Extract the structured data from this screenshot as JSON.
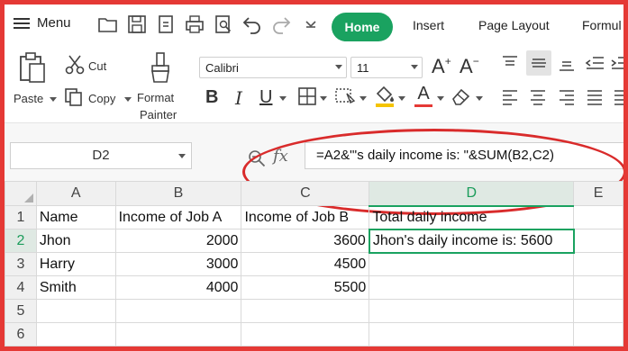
{
  "toolbar": {
    "menu_label": "Menu",
    "tabs": [
      "Home",
      "Insert",
      "Page Layout",
      "Formul"
    ],
    "accent_color": "#1aa260"
  },
  "ribbon": {
    "paste_label": "Paste",
    "cut_label": "Cut",
    "copy_label": "Copy",
    "format_painter_label_1": "Format",
    "format_painter_label_2": "Painter",
    "font_name": "Calibri",
    "font_size": "11"
  },
  "formula_bar": {
    "cell_reference": "D2",
    "fx_label": "fx",
    "formula": "=A2&\"'s daily income is: \"&SUM(B2,C2)"
  },
  "sheet": {
    "columns": [
      "A",
      "B",
      "C",
      "D",
      "E"
    ],
    "row_numbers": [
      "1",
      "2",
      "3",
      "4",
      "5",
      "6"
    ],
    "rows": [
      [
        "Name",
        "Income of Job A",
        "Income of Job B",
        "Total daily income"
      ],
      [
        "Jhon",
        "2000",
        "3600",
        "Jhon's daily income is: 5600"
      ],
      [
        "Harry",
        "3000",
        "4500",
        ""
      ],
      [
        "Smith",
        "4000",
        "5500",
        ""
      ],
      [
        "",
        "",
        "",
        ""
      ],
      [
        "",
        "",
        "",
        ""
      ]
    ],
    "selected_cell": "D2"
  }
}
